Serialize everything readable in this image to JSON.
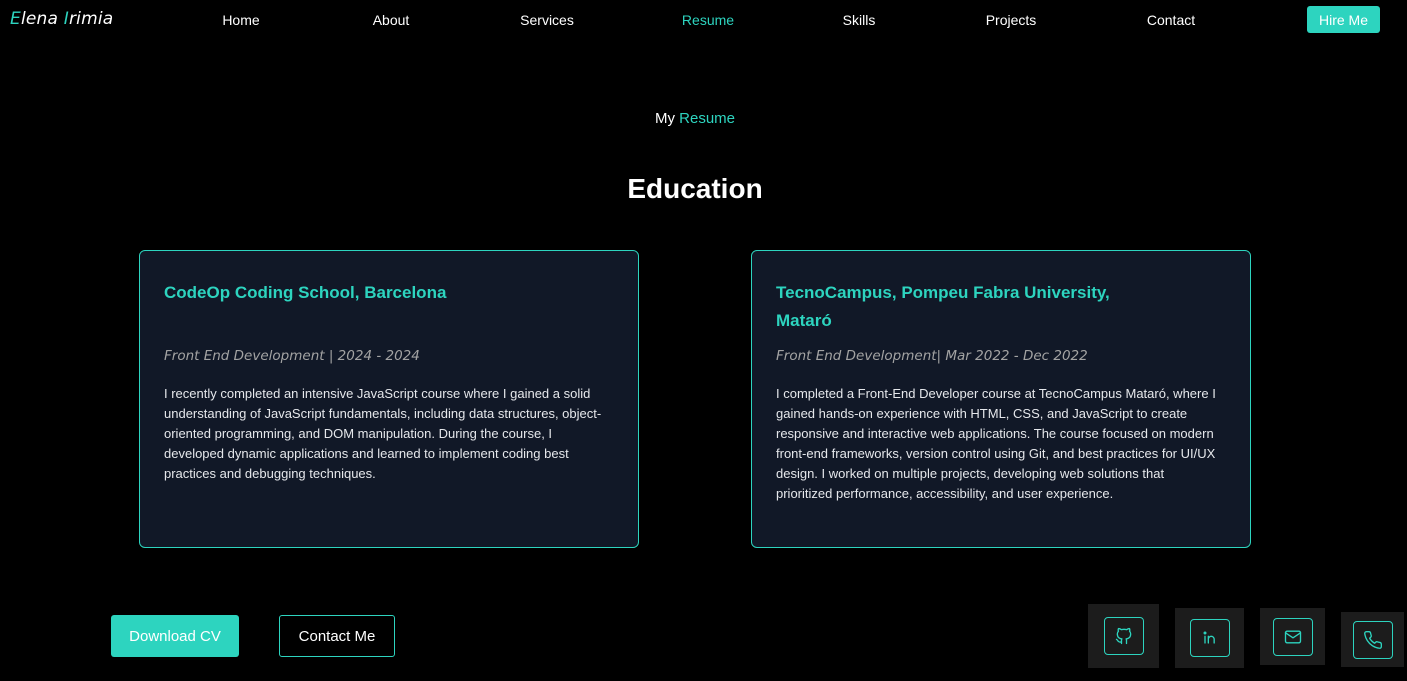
{
  "brand": {
    "first": "Elena",
    "last": "Irimia",
    "accent_color": "#2dd4bf"
  },
  "nav": {
    "items": [
      {
        "label": "Home"
      },
      {
        "label": "About"
      },
      {
        "label": "Services"
      },
      {
        "label": "Resume",
        "active": true
      },
      {
        "label": "Skills"
      },
      {
        "label": "Projects"
      },
      {
        "label": "Contact"
      }
    ],
    "hire_label": "Hire Me"
  },
  "section": {
    "subtitle_prefix": "My",
    "subtitle_highlight": "Resume",
    "title": "Education"
  },
  "education": [
    {
      "title": "CodeOp Coding School, Barcelona",
      "meta": "Front End Development | 2024 - 2024",
      "description": "I recently completed an intensive JavaScript course where I gained a solid understanding of JavaScript fundamentals, including data structures, object-oriented programming, and DOM manipulation. During the course, I developed dynamic applications and learned to implement coding best practices and debugging techniques."
    },
    {
      "title": "TecnoCampus, Pompeu Fabra University, Mataró",
      "meta": "Front End Development| Mar 2022 - Dec 2022",
      "description": "I completed a Front-End Developer course at TecnoCampus Mataró, where I gained hands-on experience with HTML, CSS, and JavaScript to create responsive and interactive web applications. The course focused on modern front-end frameworks, version control using Git, and best practices for UI/UX design. I worked on multiple projects, developing web solutions that prioritized performance, accessibility, and user experience."
    }
  ],
  "actions": {
    "download_cv": "Download CV",
    "contact_me": "Contact Me"
  },
  "social": [
    {
      "icon": "github-icon"
    },
    {
      "icon": "linkedin-icon"
    },
    {
      "icon": "mail-icon"
    },
    {
      "icon": "phone-icon"
    }
  ]
}
